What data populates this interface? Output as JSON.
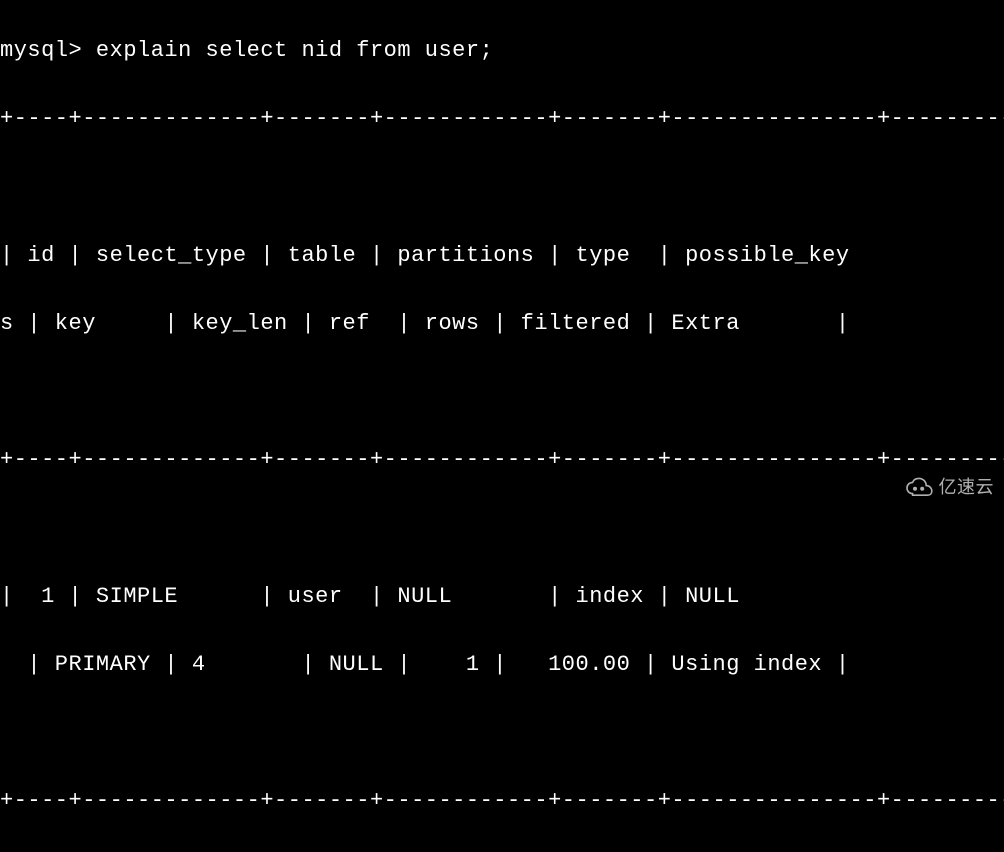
{
  "prompt": "mysql> ",
  "command": "explain select nid from user;",
  "border_top": "+----+-------------+-------+------------+-------+---------------+---------+---------+------+------+----------+-------------+",
  "header_line1": "| id | select_type | table | partitions | type  | possible_key",
  "header_line2": "s | key     | key_len | ref  | rows | filtered | Extra       |",
  "border_mid": "+----+-------------+-------+------------+-------+---------------+---------+---------+------+------+----------+-------------+",
  "data_line1": "|  1 | SIMPLE      | user  | NULL       | index | NULL         ",
  "data_line2": "  | PRIMARY | 4       | NULL |    1 |   100.00 | Using index |",
  "border_bot": "+----+-------------+-------+------------+-------+---------------+---------+---------+------+------+----------+-------------+",
  "watermark_text": "亿速云",
  "chart_data": {
    "type": "table",
    "columns": [
      "id",
      "select_type",
      "table",
      "partitions",
      "type",
      "possible_keys",
      "key",
      "key_len",
      "ref",
      "rows",
      "filtered",
      "Extra"
    ],
    "rows": [
      {
        "id": 1,
        "select_type": "SIMPLE",
        "table": "user",
        "partitions": "NULL",
        "type": "index",
        "possible_keys": "NULL",
        "key": "PRIMARY",
        "key_len": 4,
        "ref": "NULL",
        "rows": 1,
        "filtered": 100.0,
        "Extra": "Using index"
      }
    ]
  }
}
